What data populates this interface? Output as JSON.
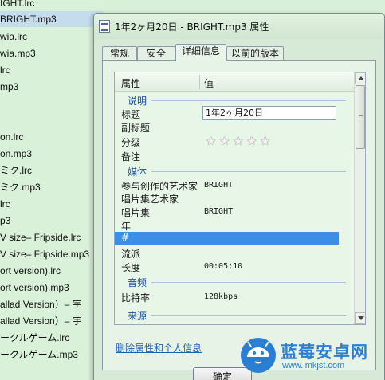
{
  "background_files": [
    "IGHT.lrc",
    "BRIGHT.mp3",
    "wia.lrc",
    "wia.mp3",
    "lrc",
    "mp3",
    "",
    "on.lrc",
    "on.mp3",
    "ミク.lrc",
    "ミク.mp3",
    "lrc",
    "p3",
    "V  size– Fripside.lrc",
    "V  size– Fripside.mp3",
    "ort version).lrc",
    "ort version).mp3",
    "allad  Version）– 宇",
    "allad  Version）– 宇",
    "ークルゲーム.lrc",
    "ークルゲーム.mp3"
  ],
  "dialog": {
    "title": "1年2ヶ月20日 - BRIGHT.mp3 属性",
    "tabs": [
      "常规",
      "安全",
      "详细信息",
      "以前的版本"
    ],
    "active_tab": "详细信息",
    "list": {
      "header_property": "属性",
      "header_value": "值",
      "groups": {
        "description": "说明",
        "media": "媒体",
        "audio": "音频",
        "origin": "来源"
      },
      "rows": {
        "title_name": "标题",
        "title_value": "1年2ヶ月20日",
        "subtitle_name": "副标题",
        "rating_name": "分级",
        "rating_stars": 0,
        "comments_name": "备注",
        "contributing_artists_name": "参与创作的艺术家",
        "contributing_artists_value": "BRIGHT",
        "album_artist_name": "唱片集艺术家",
        "album_name": "唱片集",
        "album_value": "BRIGHT",
        "year_name": "年",
        "track_name": "#",
        "genre_name": "流派",
        "length_name": "长度",
        "length_value": "00:05:10",
        "bitrate_name": "比特率",
        "bitrate_value": "128kbps"
      }
    },
    "remove_link": "删除属性和个人信息",
    "ok_button": "确定"
  },
  "watermark": {
    "brand": "蓝莓安卓网",
    "url": "www.lmkjst.com"
  },
  "colors": {
    "selection": "#3d8ee6",
    "group_heading": "#1f4fa0",
    "link": "#1f5fb8",
    "background": "#d8efd8"
  }
}
